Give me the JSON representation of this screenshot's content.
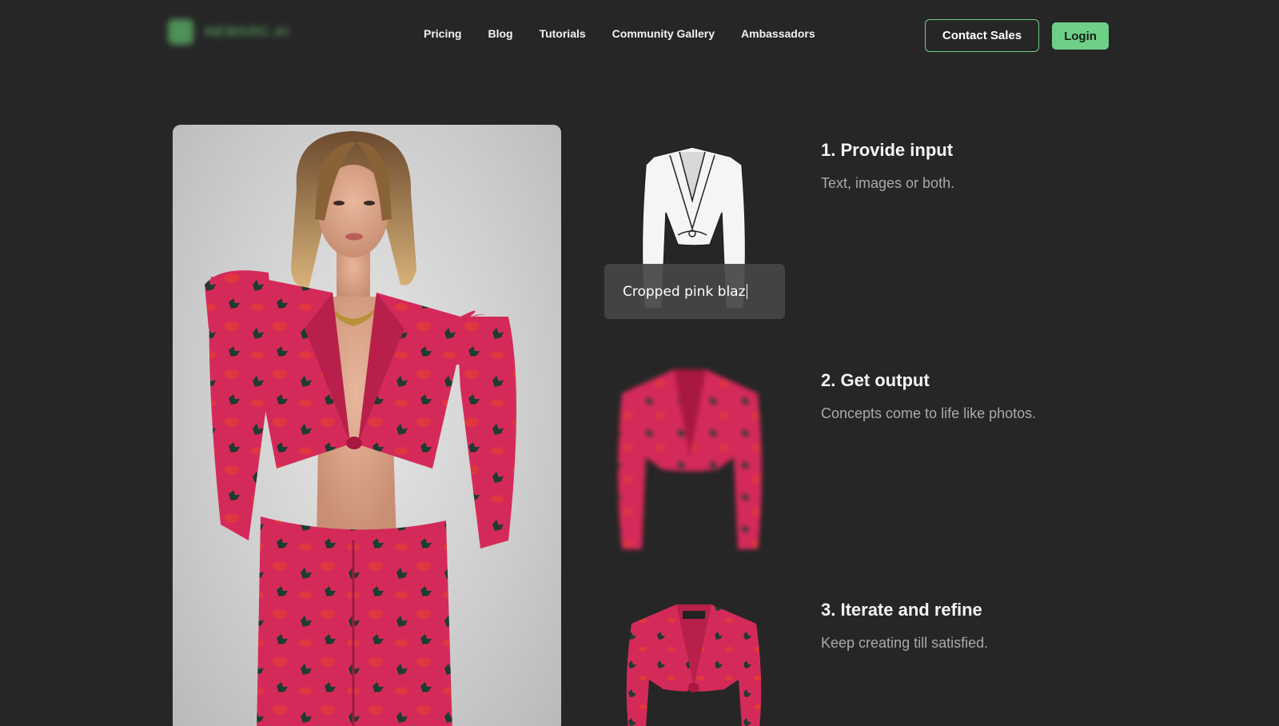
{
  "header": {
    "logo_text": "NEWARC.AI",
    "nav": [
      "Pricing",
      "Blog",
      "Tutorials",
      "Community Gallery",
      "Ambassadors"
    ],
    "contact_label": "Contact Sales",
    "login_label": "Login"
  },
  "steps": [
    {
      "title": "1. Provide input",
      "desc": "Text, images or both."
    },
    {
      "title": "2. Get output",
      "desc": "Concepts come to life like photos."
    },
    {
      "title": "3. Iterate and refine",
      "desc": "Keep creating till satisfied."
    }
  ],
  "prompt": {
    "value": "Cropped pink blaz"
  },
  "colors": {
    "background": "#262626",
    "accent": "#6ecf86",
    "garment_pink": "#d42a5a",
    "print_dark": "#1f3b34",
    "print_red": "#e23a3a",
    "muted_text": "#a9a9a9"
  },
  "icons": {
    "logo": "leaf-logo-icon"
  }
}
